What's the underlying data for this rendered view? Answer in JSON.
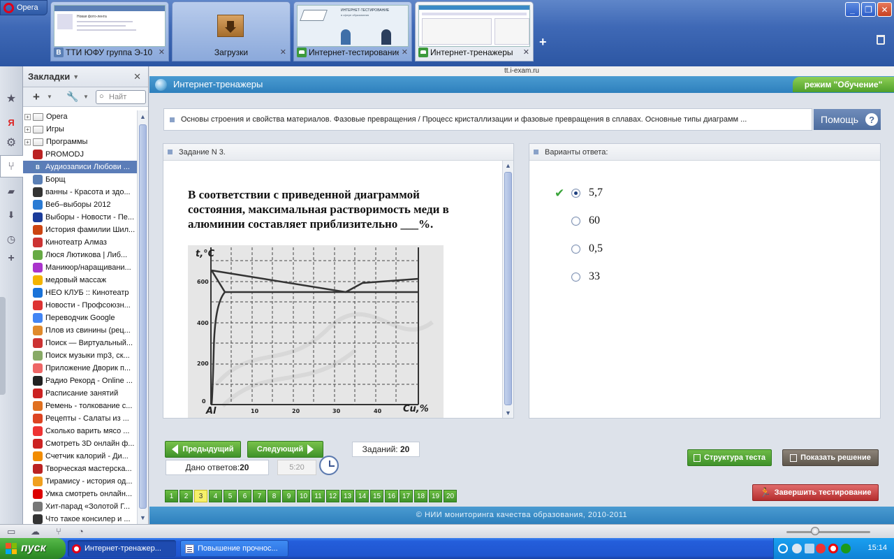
{
  "browser": {
    "menu_label": "Opera",
    "tabs": [
      {
        "title": "ТТИ ЮФУ группа Э-10",
        "favicon": "В"
      },
      {
        "title": "Загрузки"
      },
      {
        "title": "Интернет-тестирование"
      },
      {
        "title": "Интернет-тренажеры"
      }
    ],
    "thumb_text": {
      "vk_title": "Новая фото-лента",
      "itest_title": "ИНТЕРНЕТ-ТЕСТИРОВАНИЕ",
      "itest_sub": "в сфере образования"
    },
    "close_glyph": "✕",
    "add_tab": "+",
    "window_buttons": {
      "minimize": "_",
      "restore": "❐",
      "close": "✕"
    }
  },
  "bookmarks_panel": {
    "title": "Закладки",
    "search_placeholder": "Найт",
    "items": [
      {
        "label": "Opera",
        "type": "folder"
      },
      {
        "label": "Игры",
        "type": "folder"
      },
      {
        "label": "Программы",
        "type": "folder"
      },
      {
        "label": "PROMODJ",
        "type": "link",
        "color": "#b22"
      },
      {
        "label": "Аудиозаписи Любови ...",
        "type": "link",
        "color": "#5a7fb5",
        "selected": true,
        "glyph": "B"
      },
      {
        "label": "Борщ",
        "type": "link",
        "color": "#5a7fb5"
      },
      {
        "label": "ванны - Красота и здо...",
        "type": "link",
        "color": "#333"
      },
      {
        "label": "Веб–выборы 2012",
        "type": "link",
        "color": "#2a7bd4"
      },
      {
        "label": "Выборы - Новости - Пе...",
        "type": "link",
        "color": "#1b3c9a"
      },
      {
        "label": "История фамилии Шил...",
        "type": "link",
        "color": "#c41"
      },
      {
        "label": "Кинотеатр Алмаз",
        "type": "link",
        "color": "#c33"
      },
      {
        "label": "Люся Лютикова | Либ...",
        "type": "link",
        "color": "#6a4"
      },
      {
        "label": "Маникюр/наращивани...",
        "type": "link",
        "color": "#a3c"
      },
      {
        "label": "медовый массаж",
        "type": "link",
        "color": "#f4b400"
      },
      {
        "label": "НЕО КЛУБ :: Кинотеатр",
        "type": "link",
        "color": "#1a73d9"
      },
      {
        "label": "Новости - Профсоюзн...",
        "type": "link",
        "color": "#d33"
      },
      {
        "label": "Переводчик Google",
        "type": "link",
        "color": "#4285f4"
      },
      {
        "label": "Плов из свинины (рец...",
        "type": "link",
        "color": "#e08a2c"
      },
      {
        "label": "Поиск — Виртуальный...",
        "type": "link",
        "color": "#c33"
      },
      {
        "label": "Поиск музыки mp3, ск...",
        "type": "link",
        "color": "#8a6"
      },
      {
        "label": "Приложение Дворик п...",
        "type": "link",
        "color": "#e66"
      },
      {
        "label": "Радио Рекорд - Online ...",
        "type": "link",
        "color": "#222"
      },
      {
        "label": "Расписание занятий",
        "type": "link",
        "color": "#c22"
      },
      {
        "label": "Ремень - толкование с...",
        "type": "link",
        "color": "#e07020"
      },
      {
        "label": "Рецепты - Салаты из ...",
        "type": "link",
        "color": "#d42"
      },
      {
        "label": "Сколько варить мясо ...",
        "type": "link",
        "color": "#e33"
      },
      {
        "label": "Смотреть 3D онлайн ф...",
        "type": "link",
        "color": "#c22"
      },
      {
        "label": "Счетчик калорий - Ди...",
        "type": "link",
        "color": "#f28c00"
      },
      {
        "label": "Творческая мастерска...",
        "type": "link",
        "color": "#b22"
      },
      {
        "label": "Тирамису - история од...",
        "type": "link",
        "color": "#f0a020"
      },
      {
        "label": "Умка смотреть онлайн...",
        "type": "link",
        "color": "#d00"
      },
      {
        "label": "Хит-парад «Золотой Г...",
        "type": "link",
        "color": "#777"
      },
      {
        "label": "Что такое консилер и ...",
        "type": "link",
        "color": "#333"
      }
    ]
  },
  "page": {
    "address": "tt.i-exam.ru",
    "site_title": "Интернет-тренажеры",
    "mode": "режим \"Обучение\"",
    "breadcrumb": "Основы строения и свойства материалов. Фазовые превращения / Процесс кристаллизации и фазовые превращения в сплавах. Основные типы диаграмм ...",
    "help_label": "Помощь",
    "help_glyph": "?",
    "task_title": "Задание N 3.",
    "question": "В соответствии с приведенной диаграммой состояния, максимальная растворимость меди в алюминии составляет приблизительно ___%.",
    "diagram": {
      "y_label": "t,°C",
      "y_ticks": [
        "600",
        "400",
        "200",
        "0"
      ],
      "x_ticks": [
        "Al",
        "10",
        "20",
        "30",
        "40",
        "Cu,%"
      ]
    },
    "answers_title": "Варианты ответа:",
    "answers": [
      {
        "label": "5,7",
        "checked": true
      },
      {
        "label": "60",
        "checked": false
      },
      {
        "label": "0,5",
        "checked": false
      },
      {
        "label": "33",
        "checked": false
      }
    ],
    "prev_label": "Предыдущий",
    "next_label": "Следующий",
    "tasks_label": "Заданий:",
    "tasks_count": "20",
    "answered_label": "Дано ответов:",
    "answered_count": "20",
    "timer": "5:20",
    "structure_label": "Структура теста",
    "solution_label": "Показать решение",
    "finish_label": "Завершить тестирование",
    "pages": [
      "1",
      "2",
      "3",
      "4",
      "5",
      "6",
      "7",
      "8",
      "9",
      "10",
      "11",
      "12",
      "13",
      "14",
      "15",
      "16",
      "17",
      "18",
      "19",
      "20"
    ],
    "current_page": "3",
    "footer": "© НИИ мониторинга качества образования, 2010-2011"
  },
  "taskbar": {
    "start_label": "пуск",
    "tasks": [
      {
        "label": "Интернет-тренажер..."
      },
      {
        "label": "Повышение прочнос..."
      }
    ],
    "clock": "15:14"
  },
  "colors": {
    "site_blue": "#2e80bd",
    "green_button": "#3f922a",
    "finish_red": "#b52e2e",
    "current_page": "#f6f06a"
  }
}
